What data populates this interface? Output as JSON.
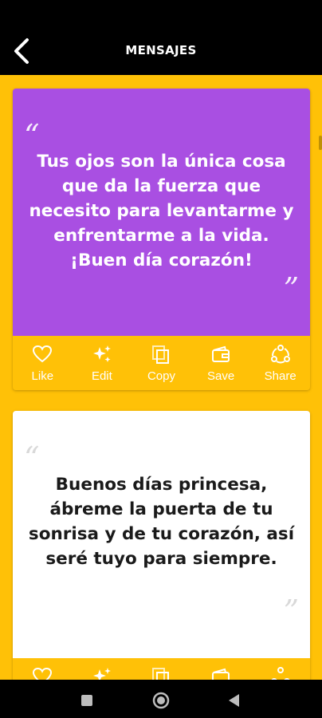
{
  "header": {
    "title": "MENSAJES"
  },
  "cards": [
    {
      "message": "Tus ojos son la única cosa que da la fuerza que necesito para levantarme y enfrentarme a la vida. ¡Buen día corazón!",
      "background": "#A94FE2",
      "text_color": "#FFFFFF",
      "actions": [
        {
          "label": "Like",
          "icon": "heart-icon"
        },
        {
          "label": "Edit",
          "icon": "sparkle-icon"
        },
        {
          "label": "Copy",
          "icon": "copy-icon"
        },
        {
          "label": "Save",
          "icon": "wallet-icon"
        },
        {
          "label": "Share",
          "icon": "share-icon"
        }
      ]
    },
    {
      "message": "Buenos días princesa, ábreme la puerta de tu sonrisa y de tu corazón, así seré tuyo para siempre.",
      "background": "#FFFFFF",
      "text_color": "#1A1A1A",
      "actions": [
        {
          "icon": "heart-icon"
        },
        {
          "icon": "sparkle-icon"
        },
        {
          "icon": "copy-icon"
        },
        {
          "icon": "wallet-icon"
        },
        {
          "icon": "share-icon"
        }
      ]
    }
  ],
  "colors": {
    "accent": "#FFC107",
    "header": "#000000"
  }
}
